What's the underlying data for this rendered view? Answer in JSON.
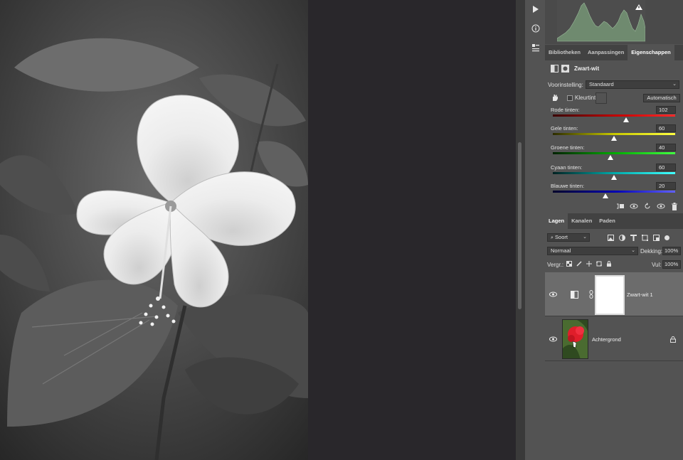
{
  "tools": {
    "play_icon": "play-icon",
    "info_icon": "info-icon",
    "properties_icon": "properties-icon"
  },
  "properties_tabs": [
    {
      "label": "Bibliotheken",
      "active": false
    },
    {
      "label": "Aanpassingen",
      "active": false
    },
    {
      "label": "Eigenschappen",
      "active": true
    }
  ],
  "properties": {
    "title": "Zwart-wit",
    "preset_label": "Voorinstelling:",
    "preset_value": "Standaard",
    "tint_label": "Kleurtint",
    "tint_checked": false,
    "auto_label": "Automatisch",
    "sliders": [
      {
        "label": "Rode tinten:",
        "value": "102",
        "percent": 0.6,
        "gradient": [
          "#3a0000",
          "#c00000",
          "#ff2a2a"
        ]
      },
      {
        "label": "Gele tinten:",
        "value": "60",
        "percent": 0.5,
        "gradient": [
          "#2b2b00",
          "#c8c800",
          "#ffff40"
        ]
      },
      {
        "label": "Groene tinten:",
        "value": "40",
        "percent": 0.47,
        "gradient": [
          "#002200",
          "#00aa00",
          "#40ff40"
        ]
      },
      {
        "label": "Cyaan tinten:",
        "value": "60",
        "percent": 0.5,
        "gradient": [
          "#002222",
          "#00aaaa",
          "#40ffff"
        ]
      },
      {
        "label": "Blauwe tinten:",
        "value": "20",
        "percent": 0.43,
        "gradient": [
          "#00002a",
          "#0000b0",
          "#6060ff"
        ]
      }
    ]
  },
  "layers_tabs": [
    {
      "label": "Lagen",
      "active": true
    },
    {
      "label": "Kanalen",
      "active": false
    },
    {
      "label": "Paden",
      "active": false
    }
  ],
  "layers": {
    "filter_kind": "Soort",
    "blend_mode": "Normaal",
    "opacity_label": "Dekking:",
    "opacity_value": "100%",
    "lock_label": "Vergr.:",
    "fill_label": "Vul:",
    "fill_value": "100%",
    "items": [
      {
        "name": "Zwart-wit 1",
        "selected": true,
        "visible": true
      },
      {
        "name": "Achtergrond",
        "selected": false,
        "visible": true,
        "locked": true
      }
    ]
  },
  "colors": {
    "panel_bg": "#535353",
    "canvas_bg": "#29272b",
    "selected_layer": "#6c6c6c"
  }
}
